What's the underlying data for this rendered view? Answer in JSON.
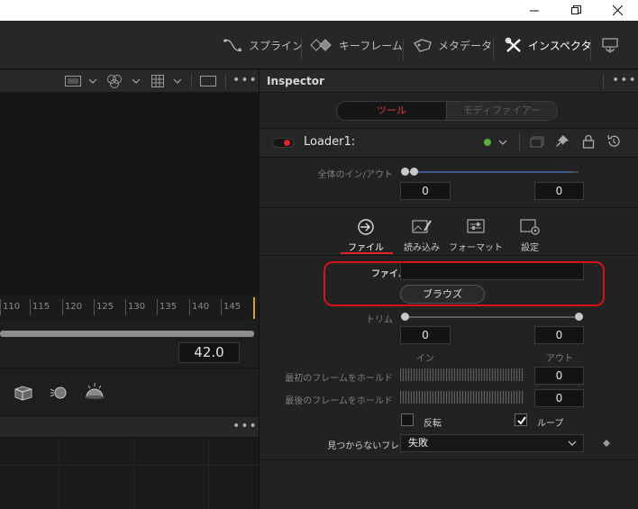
{
  "toolbar": {
    "spline_label": "スプライン",
    "keyframe_label": "キーフレーム",
    "metadata_label": "メタデータ",
    "inspector_label": "インスペクタ"
  },
  "viewer": {
    "ruler_ticks": [
      "110",
      "115",
      "120",
      "125",
      "130",
      "135",
      "140",
      "145"
    ],
    "time_value": "42.0"
  },
  "inspector": {
    "title": "Inspector",
    "tabs_top": {
      "tools": "ツール",
      "modifiers": "モディファイアー"
    },
    "node_name": "Loader1:",
    "global_inout_label": "全体のイン/アウト",
    "global_in_value": "0",
    "global_out_value": "0",
    "subtabs": {
      "file": "ファイル",
      "import": "読み込み",
      "format": "フォーマット",
      "settings": "設定"
    },
    "filename_label": "ファイル名",
    "filename_value": "",
    "browse_label": "ブラウズ",
    "trim_label": "トリム",
    "trim_in_value": "0",
    "trim_out_value": "0",
    "in_label": "イン",
    "out_label": "アウト",
    "hold_first_label": "最初のフレームをホールド",
    "hold_first_value": "0",
    "hold_last_label": "最後のフレームをホールド",
    "hold_last_value": "0",
    "reverse_label": "反転",
    "loop_label": "ループ",
    "missing_frames_label": "見つからないフレーム",
    "missing_frames_value": "失敗"
  },
  "colors": {
    "accent_red": "#e0202a",
    "active_green": "#55b03a",
    "highlight_outline": "#d4121c"
  }
}
